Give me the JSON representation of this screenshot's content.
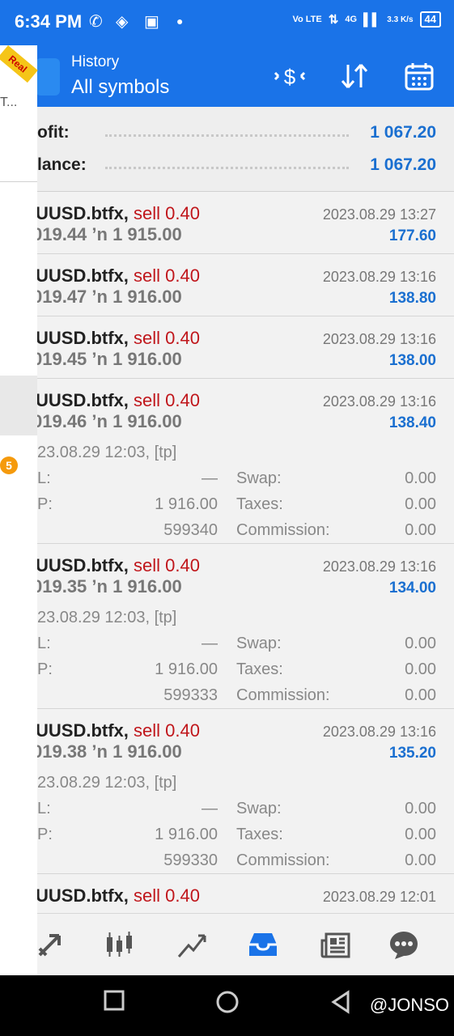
{
  "status": {
    "time": "6:34 PM",
    "net_text": "Vo LTE",
    "signal_text": "4G",
    "speed": "3.3 K/s",
    "battery": "44"
  },
  "appbar": {
    "title_small": "History",
    "title_large": "All symbols"
  },
  "drawer": {
    "ribbon": "Real",
    "truncated": "T...",
    "badge": "5"
  },
  "summary": {
    "profit_label": "ofit:",
    "profit_value": "1 067.20",
    "balance_label": "lance:",
    "balance_value": "1 067.20"
  },
  "trades": [
    {
      "symbol": "UUSD.btfx,",
      "side": "sell 0.40",
      "prices": "019.44 ’n  1 915.00",
      "date": "2023.08.29 13:27",
      "profit": "177.60"
    },
    {
      "symbol": "UUSD.btfx,",
      "side": "sell 0.40",
      "prices": "019.47 ’n  1 916.00",
      "date": "2023.08.29 13:16",
      "profit": "138.80"
    },
    {
      "symbol": "UUSD.btfx,",
      "side": "sell 0.40",
      "prices": "019.45 ’n  1 916.00",
      "date": "2023.08.29 13:16",
      "profit": "138.00"
    },
    {
      "symbol": "UUSD.btfx,",
      "side": "sell 0.40",
      "prices": "019.46 ’n  1 916.00",
      "date": "2023.08.29 13:16",
      "profit": "138.40",
      "open_time": "23.08.29 12:03, [tp]",
      "sl_label": "L:",
      "sl_value": "—",
      "tp_label": "P:",
      "tp_value": "1 916.00",
      "ticket": "599340",
      "swap_label": "Swap:",
      "swap": "0.00",
      "taxes_label": "Taxes:",
      "taxes": "0.00",
      "commission_label": "Commission:",
      "commission": "0.00"
    },
    {
      "symbol": "UUSD.btfx,",
      "side": "sell 0.40",
      "prices": "019.35 ’n  1 916.00",
      "date": "2023.08.29 13:16",
      "profit": "134.00",
      "open_time": "23.08.29 12:03, [tp]",
      "sl_label": "L:",
      "sl_value": "—",
      "tp_label": "P:",
      "tp_value": "1 916.00",
      "ticket": "599333",
      "swap_label": "Swap:",
      "swap": "0.00",
      "taxes_label": "Taxes:",
      "taxes": "0.00",
      "commission_label": "Commission:",
      "commission": "0.00"
    },
    {
      "symbol": "UUSD.btfx,",
      "side": "sell 0.40",
      "prices": "019.38 ’n  1 916.00",
      "date": "2023.08.29 13:16",
      "profit": "135.20",
      "open_time": "23.08.29 12:03, [tp]",
      "sl_label": "L:",
      "sl_value": "—",
      "tp_label": "P:",
      "tp_value": "1 916.00",
      "ticket": "599330",
      "swap_label": "Swap:",
      "swap": "0.00",
      "taxes_label": "Taxes:",
      "taxes": "0.00",
      "commission_label": "Commission:",
      "commission": "0.00"
    },
    {
      "symbol": "UUSD.btfx,",
      "side": "sell 0.40",
      "date": "2023.08.29 12:01"
    }
  ],
  "watermark": "@JONSO"
}
